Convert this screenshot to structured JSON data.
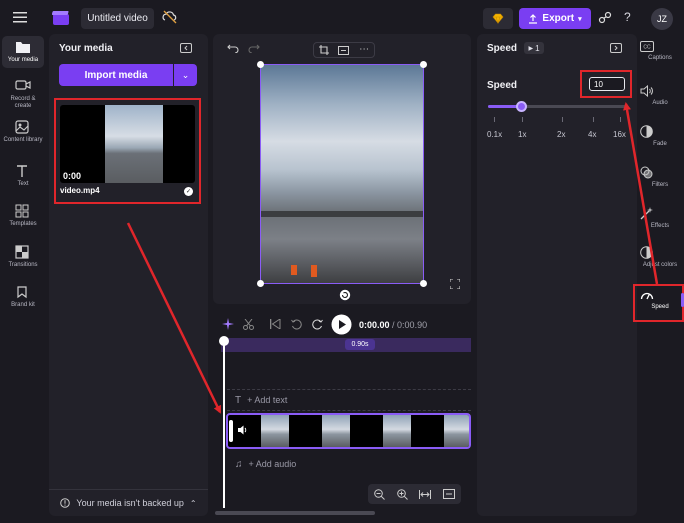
{
  "topbar": {
    "project_title": "Untitled video",
    "export_label": "Export",
    "help_glyph": "?",
    "avatar_initials": "JZ"
  },
  "left_rail": [
    {
      "label": "Your media",
      "icon": "folder-icon"
    },
    {
      "label": "Record & create",
      "icon": "camera-icon"
    },
    {
      "label": "Content library",
      "icon": "library-icon"
    },
    {
      "label": "Text",
      "icon": "text-icon"
    },
    {
      "label": "Templates",
      "icon": "templates-icon"
    },
    {
      "label": "Transitions",
      "icon": "transitions-icon"
    },
    {
      "label": "Brand kit",
      "icon": "brand-kit-icon"
    }
  ],
  "media_panel": {
    "title": "Your media",
    "import_label": "Import media",
    "item": {
      "duration": "0:00",
      "filename": "video.mp4"
    },
    "backup_notice": "Your media isn't backed up"
  },
  "timeline": {
    "current_time": "0:00.00",
    "separator": " / ",
    "total_time": "0:00.90",
    "clip_length_badge": "0.90s",
    "add_text_label": "+ Add text",
    "add_audio_label": "+ Add audio"
  },
  "speed_panel": {
    "header": "Speed",
    "badge_count": "1",
    "speed_label": "Speed",
    "speed_value": "10",
    "slider_fraction": 0.245,
    "ticks": [
      "0.1x",
      "1x",
      "2x",
      "4x",
      "16x"
    ]
  },
  "right_rail": [
    {
      "label": "Captions",
      "icon": "captions-icon"
    },
    {
      "label": "Audio",
      "icon": "audio-icon"
    },
    {
      "label": "Fade",
      "icon": "fade-icon"
    },
    {
      "label": "Filters",
      "icon": "filters-icon"
    },
    {
      "label": "Effects",
      "icon": "effects-icon"
    },
    {
      "label": "Adjust colors",
      "icon": "adjust-colors-icon"
    },
    {
      "label": "Speed",
      "icon": "speed-icon"
    }
  ],
  "colors": {
    "accent": "#7a3ef2",
    "annotation_red": "#e0262b",
    "panel_bg": "#222129",
    "app_bg": "#1b1a21"
  }
}
